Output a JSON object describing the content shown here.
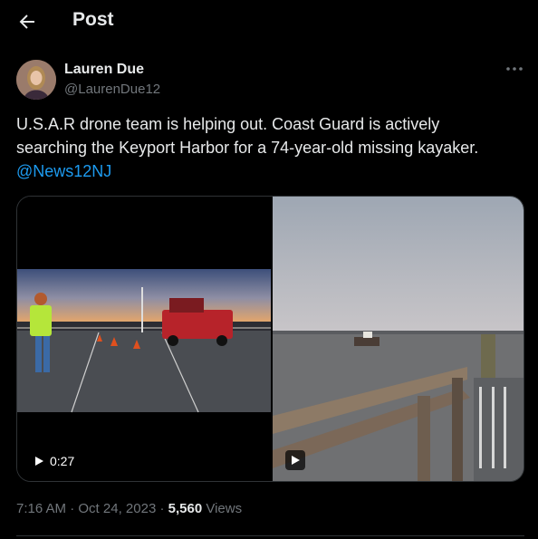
{
  "header": {
    "title": "Post",
    "back_icon": "arrow-left-icon"
  },
  "author": {
    "name": "Lauren Due",
    "handle": "@LaurenDue12",
    "avatar_icon": "avatar"
  },
  "more_icon": "more-horizontal-icon",
  "tweet": {
    "line1": "U.S.A.R drone team is helping out. Coast Guard is actively",
    "line2": "searching the Keyport Harbor for a 74-year-old missing kayaker.",
    "mention": "@News12NJ"
  },
  "media": {
    "video1": {
      "duration": "0:27",
      "play_icon": "play-icon"
    },
    "video2": {
      "play_icon": "play-icon"
    }
  },
  "meta": {
    "time": "7:16 AM",
    "sep1": "·",
    "date": "Oct 24, 2023",
    "sep2": "·",
    "views_count": "5,560",
    "views_label": "Views"
  },
  "colors": {
    "accent": "#1d9bf0",
    "text": "#e7e9ea",
    "muted": "#71767b",
    "border": "#2f3336"
  }
}
